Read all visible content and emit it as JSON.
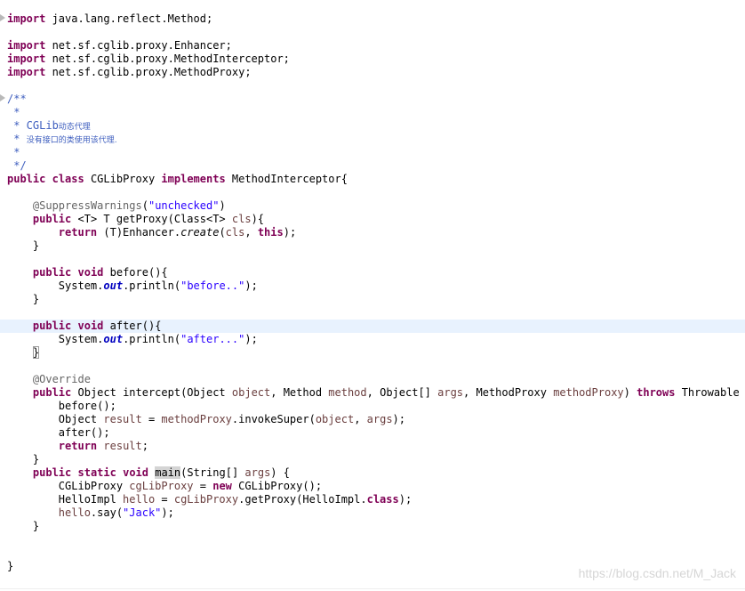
{
  "editor": {
    "lines": [
      [
        {
          "t": "import",
          "c": "kw"
        },
        {
          "t": " java.lang.reflect.Method;"
        }
      ],
      [],
      [
        {
          "t": "import",
          "c": "kw"
        },
        {
          "t": " net.sf.cglib.proxy.Enhancer;"
        }
      ],
      [
        {
          "t": "import",
          "c": "kw"
        },
        {
          "t": " net.sf.cglib.proxy.MethodInterceptor;"
        }
      ],
      [
        {
          "t": "import",
          "c": "kw"
        },
        {
          "t": " net.sf.cglib.proxy.MethodProxy;"
        }
      ],
      [],
      [
        {
          "t": "/**",
          "c": "com"
        }
      ],
      [
        {
          "t": " *",
          "c": "com"
        }
      ],
      [
        {
          "t": " * CGLib",
          "c": "com"
        },
        {
          "t": "动态代理",
          "c": "com cjk"
        }
      ],
      [
        {
          "t": " * ",
          "c": "com"
        },
        {
          "t": "没有接口的类使用该代理.",
          "c": "com cjk"
        }
      ],
      [
        {
          "t": " *",
          "c": "com"
        }
      ],
      [
        {
          "t": " */",
          "c": "com"
        }
      ],
      [
        {
          "t": "public",
          "c": "kw"
        },
        {
          "t": " "
        },
        {
          "t": "class",
          "c": "kw"
        },
        {
          "t": " CGLibProxy "
        },
        {
          "t": "implements",
          "c": "kw"
        },
        {
          "t": " MethodInterceptor{"
        }
      ],
      [],
      [
        {
          "t": "    "
        },
        {
          "t": "@SuppressWarnings",
          "c": "ann"
        },
        {
          "t": "("
        },
        {
          "t": "\"unchecked\"",
          "c": "str"
        },
        {
          "t": ")"
        }
      ],
      [
        {
          "t": "    "
        },
        {
          "t": "public",
          "c": "kw"
        },
        {
          "t": " <T> T getProxy(Class<T> "
        },
        {
          "t": "cls",
          "c": "var"
        },
        {
          "t": "){"
        }
      ],
      [
        {
          "t": "        "
        },
        {
          "t": "return",
          "c": "kw"
        },
        {
          "t": " (T)Enhancer."
        },
        {
          "t": "create",
          "c": "static"
        },
        {
          "t": "("
        },
        {
          "t": "cls",
          "c": "var"
        },
        {
          "t": ", "
        },
        {
          "t": "this",
          "c": "kw"
        },
        {
          "t": ");"
        }
      ],
      [
        {
          "t": "    }"
        }
      ],
      [],
      [
        {
          "t": "    "
        },
        {
          "t": "public",
          "c": "kw"
        },
        {
          "t": " "
        },
        {
          "t": "void",
          "c": "kw"
        },
        {
          "t": " before(){"
        }
      ],
      [
        {
          "t": "        System."
        },
        {
          "t": "out",
          "c": "field"
        },
        {
          "t": ".println("
        },
        {
          "t": "\"before..\"",
          "c": "str"
        },
        {
          "t": ");"
        }
      ],
      [
        {
          "t": "    }"
        }
      ],
      [],
      [
        {
          "t": "    "
        },
        {
          "t": "public",
          "c": "kw"
        },
        {
          "t": " "
        },
        {
          "t": "void",
          "c": "kw"
        },
        {
          "t": " after(){"
        }
      ],
      [
        {
          "t": "        System."
        },
        {
          "t": "out",
          "c": "field"
        },
        {
          "t": ".println("
        },
        {
          "t": "\"after...\"",
          "c": "str"
        },
        {
          "t": ");"
        }
      ],
      [
        {
          "t": "    "
        },
        {
          "t": "}",
          "c": "cursor"
        }
      ],
      [],
      [
        {
          "t": "    "
        },
        {
          "t": "@Override",
          "c": "ann"
        }
      ],
      [
        {
          "t": "    "
        },
        {
          "t": "public",
          "c": "kw"
        },
        {
          "t": " Object intercept(Object "
        },
        {
          "t": "object",
          "c": "var"
        },
        {
          "t": ", Method "
        },
        {
          "t": "method",
          "c": "var"
        },
        {
          "t": ", Object[] "
        },
        {
          "t": "args",
          "c": "var"
        },
        {
          "t": ", MethodProxy "
        },
        {
          "t": "methodProxy",
          "c": "var"
        },
        {
          "t": ") "
        },
        {
          "t": "throws",
          "c": "kw"
        },
        {
          "t": " Throwable {"
        }
      ],
      [
        {
          "t": "        before();"
        }
      ],
      [
        {
          "t": "        Object "
        },
        {
          "t": "result",
          "c": "var"
        },
        {
          "t": " = "
        },
        {
          "t": "methodProxy",
          "c": "var"
        },
        {
          "t": ".invokeSuper("
        },
        {
          "t": "object",
          "c": "var"
        },
        {
          "t": ", "
        },
        {
          "t": "args",
          "c": "var"
        },
        {
          "t": ");"
        }
      ],
      [
        {
          "t": "        after();"
        }
      ],
      [
        {
          "t": "        "
        },
        {
          "t": "return",
          "c": "kw"
        },
        {
          "t": " "
        },
        {
          "t": "result",
          "c": "var"
        },
        {
          "t": ";"
        }
      ],
      [
        {
          "t": "    }"
        }
      ],
      [
        {
          "t": "    "
        },
        {
          "t": "public",
          "c": "kw"
        },
        {
          "t": " "
        },
        {
          "t": "static",
          "c": "kw"
        },
        {
          "t": " "
        },
        {
          "t": "void",
          "c": "kw"
        },
        {
          "t": " "
        },
        {
          "t": "main",
          "c": "mark"
        },
        {
          "t": "(String[] "
        },
        {
          "t": "args",
          "c": "var"
        },
        {
          "t": ") {"
        }
      ],
      [
        {
          "t": "        CGLibProxy "
        },
        {
          "t": "cgLibProxy",
          "c": "var"
        },
        {
          "t": " = "
        },
        {
          "t": "new",
          "c": "kw"
        },
        {
          "t": " CGLibProxy();"
        }
      ],
      [
        {
          "t": "        HelloImpl "
        },
        {
          "t": "hello",
          "c": "var"
        },
        {
          "t": " = "
        },
        {
          "t": "cgLibProxy",
          "c": "var"
        },
        {
          "t": ".getProxy(HelloImpl."
        },
        {
          "t": "class",
          "c": "kw"
        },
        {
          "t": ");"
        }
      ],
      [
        {
          "t": "        "
        },
        {
          "t": "hello",
          "c": "var"
        },
        {
          "t": ".say("
        },
        {
          "t": "\"Jack\"",
          "c": "str"
        },
        {
          "t": ");"
        }
      ],
      [
        {
          "t": "    }"
        }
      ],
      [],
      [],
      [
        {
          "t": "}"
        }
      ]
    ],
    "fold_marker_lines": [
      0,
      6
    ],
    "current_line": 23,
    "current_line_color": "#e8f2fe"
  },
  "colors": {
    "keyword": "#7f0055",
    "comment": "#3f5fbf",
    "string": "#2a00ff",
    "annotation": "#646464",
    "local_variable": "#6a3e3e",
    "static_field": "#0000c0"
  },
  "watermark": "https://blog.csdn.net/M_Jack"
}
